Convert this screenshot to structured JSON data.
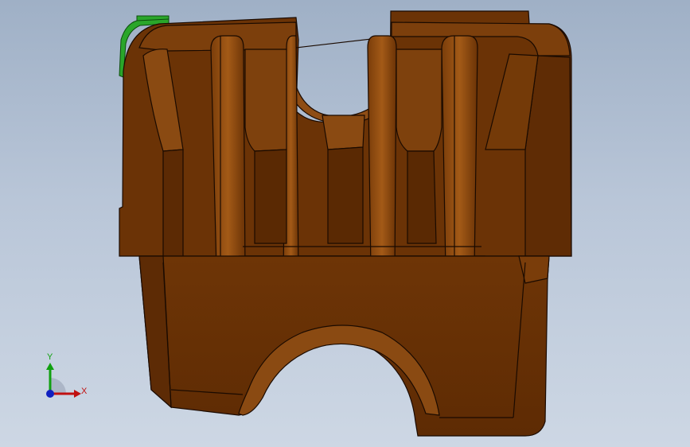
{
  "viewport": {
    "background_top": "#9fb0c6",
    "background_bottom": "#cdd7e4"
  },
  "model": {
    "body_color": "#6b3306",
    "face_light_color": "#8a4a12",
    "face_shadow_color": "#4f2404",
    "edge_color": "#1a0a00",
    "highlight_feature_color": "#2aa62a"
  },
  "triad": {
    "x_label": "X",
    "y_label": "Y",
    "x_color": "#c01010",
    "y_color": "#10a010",
    "z_color": "#1020c0"
  }
}
